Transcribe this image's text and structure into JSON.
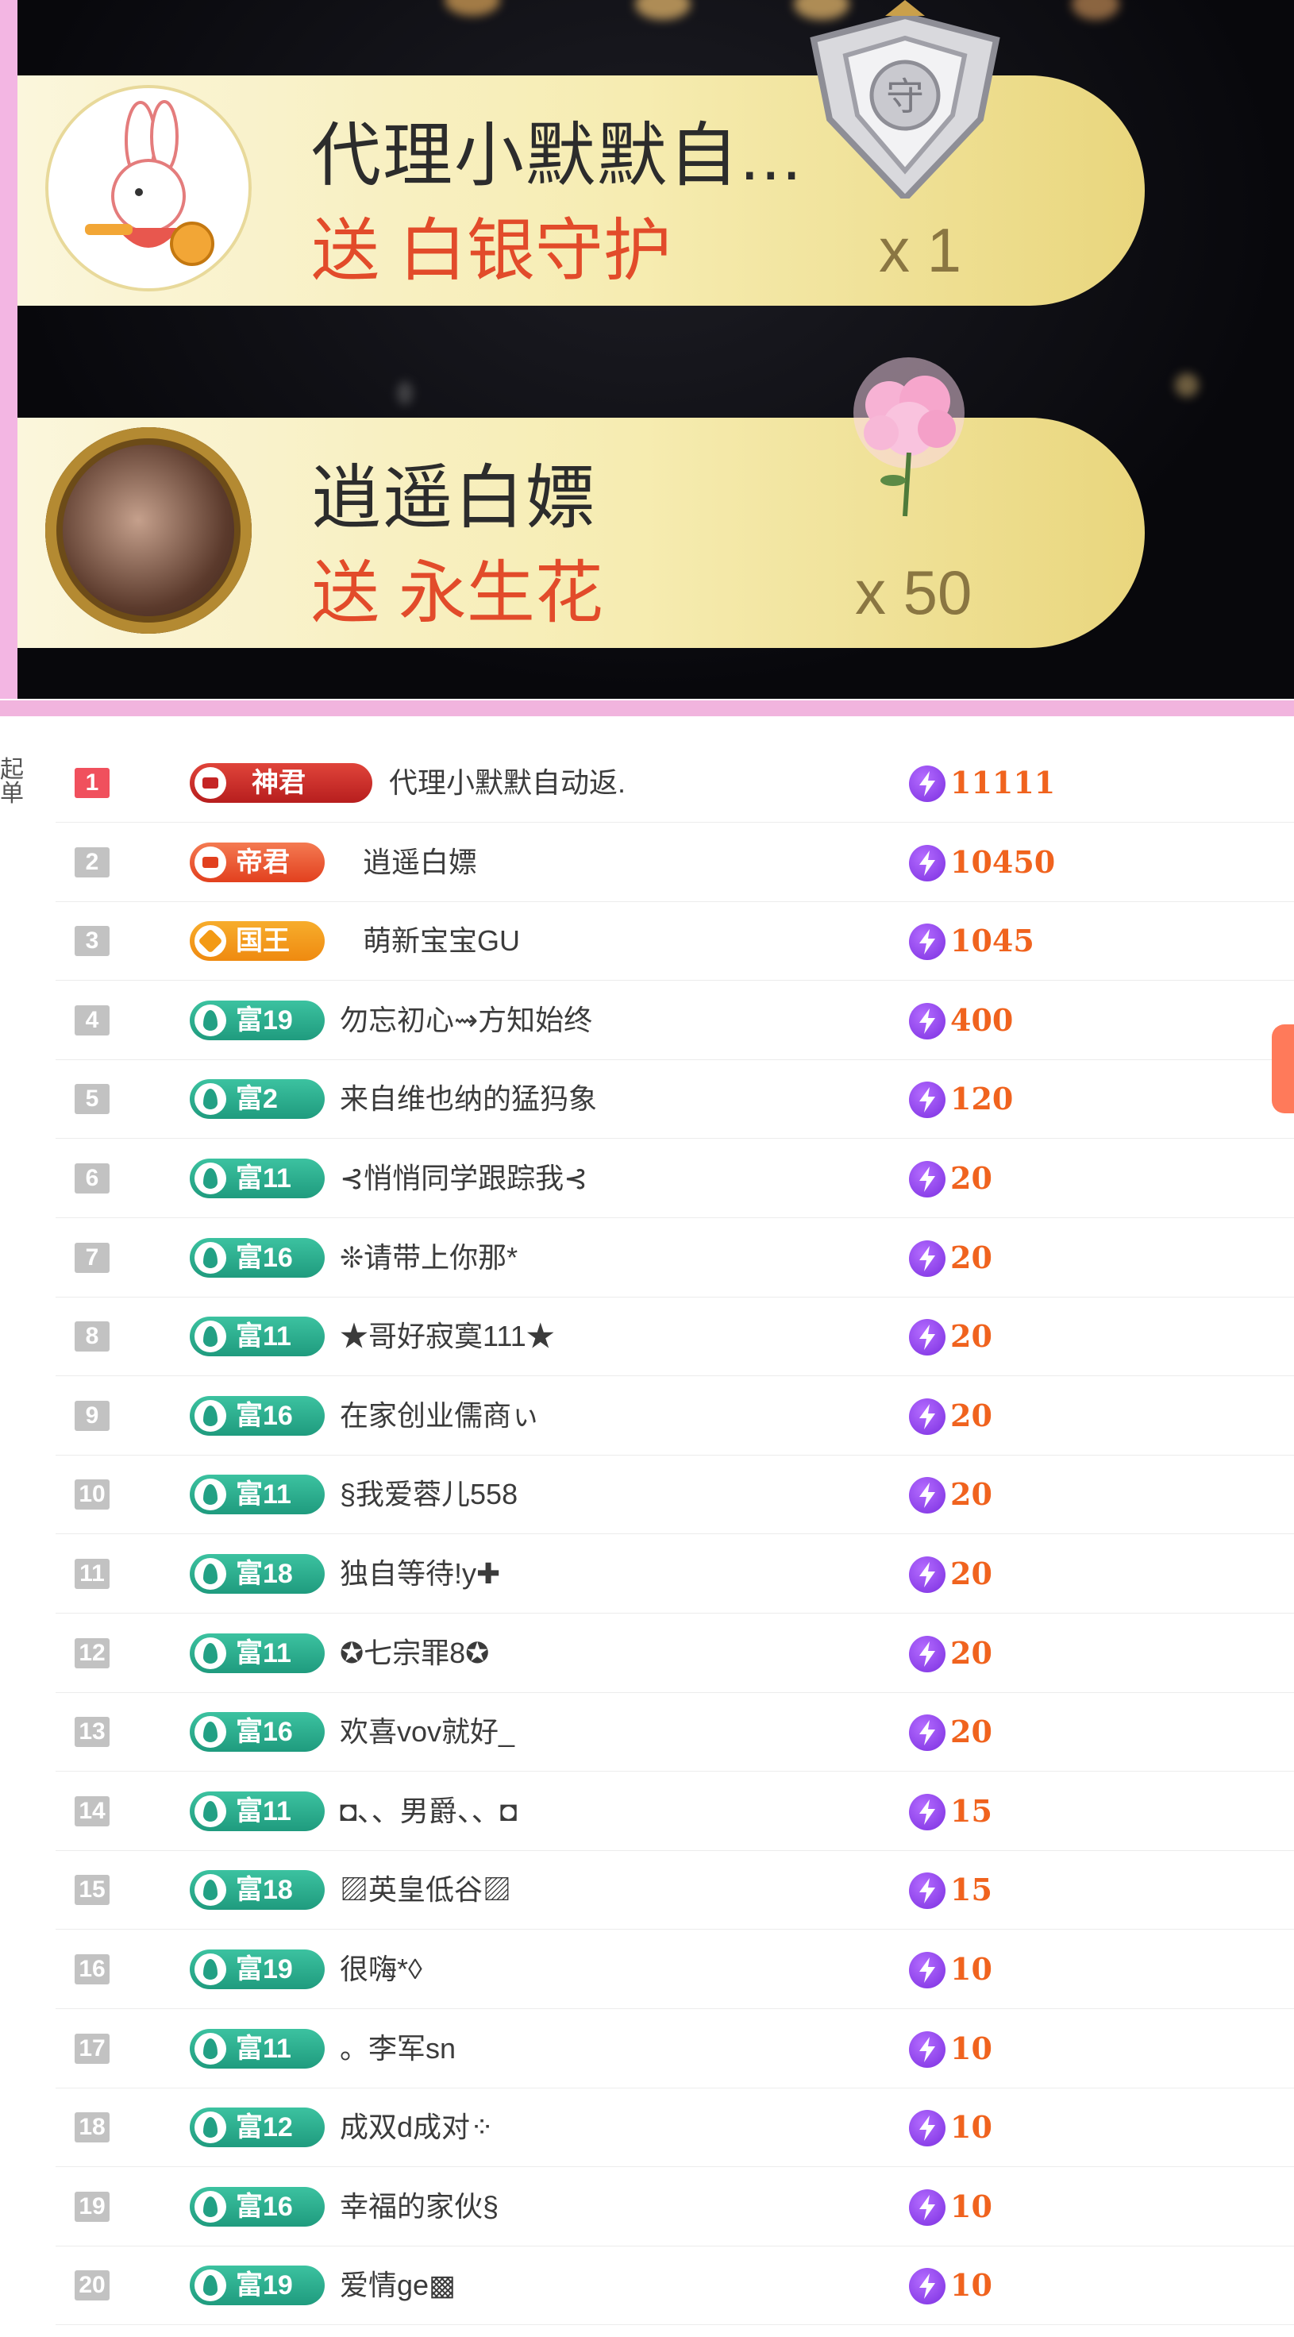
{
  "gift_feed": [
    {
      "sender": "代理小默默自...",
      "action": "送 白银守护",
      "count": "x 1",
      "gift_icon": "silver-guard-shield-icon",
      "avatar": "rabbit-avatar"
    },
    {
      "sender": "逍遥白嫖",
      "action": "送 永生花",
      "count": "x 50",
      "gift_icon": "eternal-flower-icon",
      "avatar": "user-photo-avatar"
    }
  ],
  "side_label": "起\n单",
  "ranking": [
    {
      "rank": "1",
      "badge": "神君",
      "badge_style": "deep",
      "name": "代理小默默自动返.",
      "score": "11111"
    },
    {
      "rank": "2",
      "badge": "帝君",
      "badge_style": "red",
      "name": "逍遥白嫖",
      "score": "10450"
    },
    {
      "rank": "3",
      "badge": "国王",
      "badge_style": "gold",
      "name": "萌新宝宝GU",
      "score": "1045"
    },
    {
      "rank": "4",
      "badge": "富19",
      "badge_style": "green",
      "name": "勿忘初心⇝方知始终",
      "score": "400"
    },
    {
      "rank": "5",
      "badge": "富2",
      "badge_style": "green",
      "name": "来自维也纳的猛犸象",
      "score": "120"
    },
    {
      "rank": "6",
      "badge": "富11",
      "badge_style": "green",
      "name": "⊰悄悄同学跟踪我⊰",
      "score": "20"
    },
    {
      "rank": "7",
      "badge": "富16",
      "badge_style": "green",
      "name": "❊请带上你那*",
      "score": "20"
    },
    {
      "rank": "8",
      "badge": "富11",
      "badge_style": "green",
      "name": "★哥好寂寞111★",
      "score": "20"
    },
    {
      "rank": "9",
      "badge": "富16",
      "badge_style": "green",
      "name": "在家创业儒商ぃ",
      "score": "20"
    },
    {
      "rank": "10",
      "badge": "富11",
      "badge_style": "green",
      "name": "§我爱蓉儿558",
      "score": "20"
    },
    {
      "rank": "11",
      "badge": "富18",
      "badge_style": "green",
      "name": "独自等待!y✚",
      "score": "20"
    },
    {
      "rank": "12",
      "badge": "富11",
      "badge_style": "green",
      "name": "✪七宗罪8✪",
      "score": "20"
    },
    {
      "rank": "13",
      "badge": "富16",
      "badge_style": "green",
      "name": "欢喜vov就好_",
      "score": "20"
    },
    {
      "rank": "14",
      "badge": "富11",
      "badge_style": "green",
      "name": "◘、、男爵、、◘",
      "score": "15"
    },
    {
      "rank": "15",
      "badge": "富18",
      "badge_style": "green",
      "name": "▨英皇低谷▨",
      "score": "15"
    },
    {
      "rank": "16",
      "badge": "富19",
      "badge_style": "green",
      "name": "很嗨*◊",
      "score": "10"
    },
    {
      "rank": "17",
      "badge": "富11",
      "badge_style": "green",
      "name": "。李军sn",
      "score": "10"
    },
    {
      "rank": "18",
      "badge": "富12",
      "badge_style": "green",
      "name": "成双d成对⁘",
      "score": "10"
    },
    {
      "rank": "19",
      "badge": "富16",
      "badge_style": "green",
      "name": "幸福的家伙§",
      "score": "10"
    },
    {
      "rank": "20",
      "badge": "富19",
      "badge_style": "green",
      "name": "爱情ge▩",
      "score": "10"
    }
  ],
  "colors": {
    "score": "#f0631e",
    "gift_text": "#e24b2a",
    "badge_green": "#22a084",
    "separator": "#f1b4de"
  }
}
